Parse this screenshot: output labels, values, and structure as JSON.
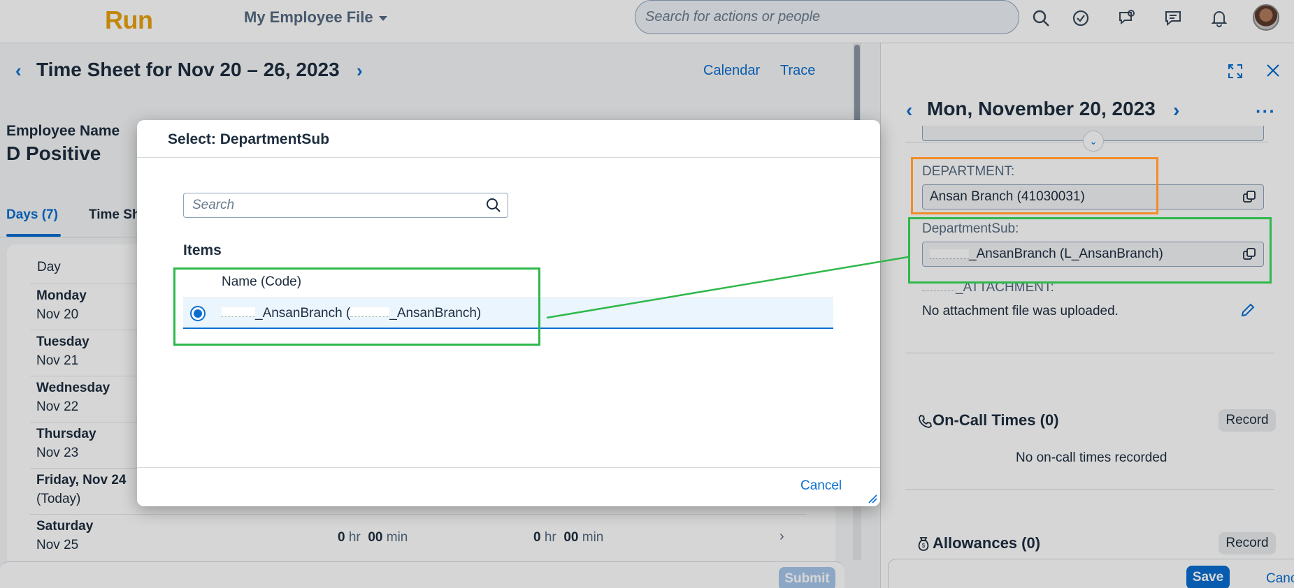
{
  "shell": {
    "logo": "Run",
    "app_title": "My Employee File",
    "search_placeholder": "Search for actions or people"
  },
  "timesheet": {
    "title": "Time Sheet for Nov 20 – 26, 2023",
    "links": {
      "calendar": "Calendar",
      "trace": "Trace"
    },
    "employee_label": "Employee Name",
    "employee_name": "D Positive",
    "tabs": [
      {
        "label": "Days (7)"
      },
      {
        "label": "Time Sh"
      }
    ],
    "day_column_header": "Day",
    "days": [
      {
        "line1": "Monday",
        "line2": "Nov 20"
      },
      {
        "line1": "Tuesday",
        "line2": "Nov 21"
      },
      {
        "line1": "Wednesday",
        "line2": "Nov 22"
      },
      {
        "line1": "Thursday",
        "line2": "Nov 23"
      },
      {
        "line1": "Friday, Nov 24",
        "line2": "(Today)"
      },
      {
        "line1": "Saturday",
        "line2": "Nov 25",
        "hours_a": {
          "h": "0",
          "hu": "hr",
          "m": "00",
          "mu": "min"
        },
        "hours_b": {
          "h": "0",
          "hu": "hr",
          "m": "00",
          "mu": "min"
        }
      }
    ],
    "submit_label": "Submit"
  },
  "side_panel": {
    "date_title": "Mon, November 20, 2023",
    "department_label": "DEPARTMENT:",
    "department_value": "Ansan Branch (41030031)",
    "departmentsub_label": "DepartmentSub:",
    "departmentsub_value": "_AnsanBranch (L_AnsanBranch)",
    "attachment_label": "_ATTACHMENT:",
    "attachment_text": "No attachment file was uploaded.",
    "oncall_title": "On-Call Times (0)",
    "oncall_empty": "No on-call times recorded",
    "allowances_title": "Allowances (0)",
    "record_label": "Record",
    "save_label": "Save",
    "cancel_label": "Cancel"
  },
  "dialog": {
    "title": "Select: DepartmentSub",
    "search_placeholder": "Search",
    "items_heading": "Items",
    "column_header": "Name (Code)",
    "row_prefix": "_AnsanBranch (",
    "row_suffix": "_AnsanBranch)",
    "cancel_label": "Cancel"
  },
  "colors": {
    "accent": "#0a6ed1",
    "logo": "#e8a10f",
    "annotation_green": "#2eb84b",
    "annotation_orange": "#f28c28"
  }
}
